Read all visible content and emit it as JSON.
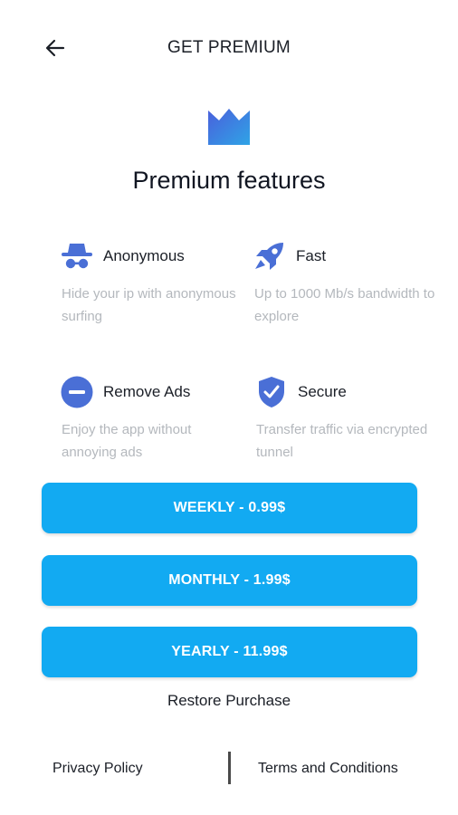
{
  "header": {
    "back_icon": "arrow-left-icon",
    "title": "GET PREMIUM"
  },
  "crown_icon": "crown-icon",
  "heading": "Premium features",
  "features": [
    {
      "icon": "incognito-icon",
      "name": "Anonymous",
      "desc": "Hide your ip with anonymous surfing"
    },
    {
      "icon": "rocket-icon",
      "name": "Fast",
      "desc": "Up to 1000 Mb/s bandwidth to explore"
    },
    {
      "icon": "minus-circle-icon",
      "name": "Remove Ads",
      "desc": "Enjoy the app without annoying ads"
    },
    {
      "icon": "shield-check-icon",
      "name": "Secure",
      "desc": "Transfer traffic via encrypted tunnel"
    }
  ],
  "plans": [
    {
      "label": "WEEKLY - 0.99$"
    },
    {
      "label": "MONTHLY - 1.99$"
    },
    {
      "label": "YEARLY - 11.99$"
    }
  ],
  "restore_label": "Restore Purchase",
  "footer": {
    "privacy_label": "Privacy Policy",
    "terms_label": "Terms and Conditions"
  },
  "colors": {
    "accent": "#12aaf2",
    "icon_blue": "#4a6fd6",
    "muted_text": "#b4b8bd"
  }
}
